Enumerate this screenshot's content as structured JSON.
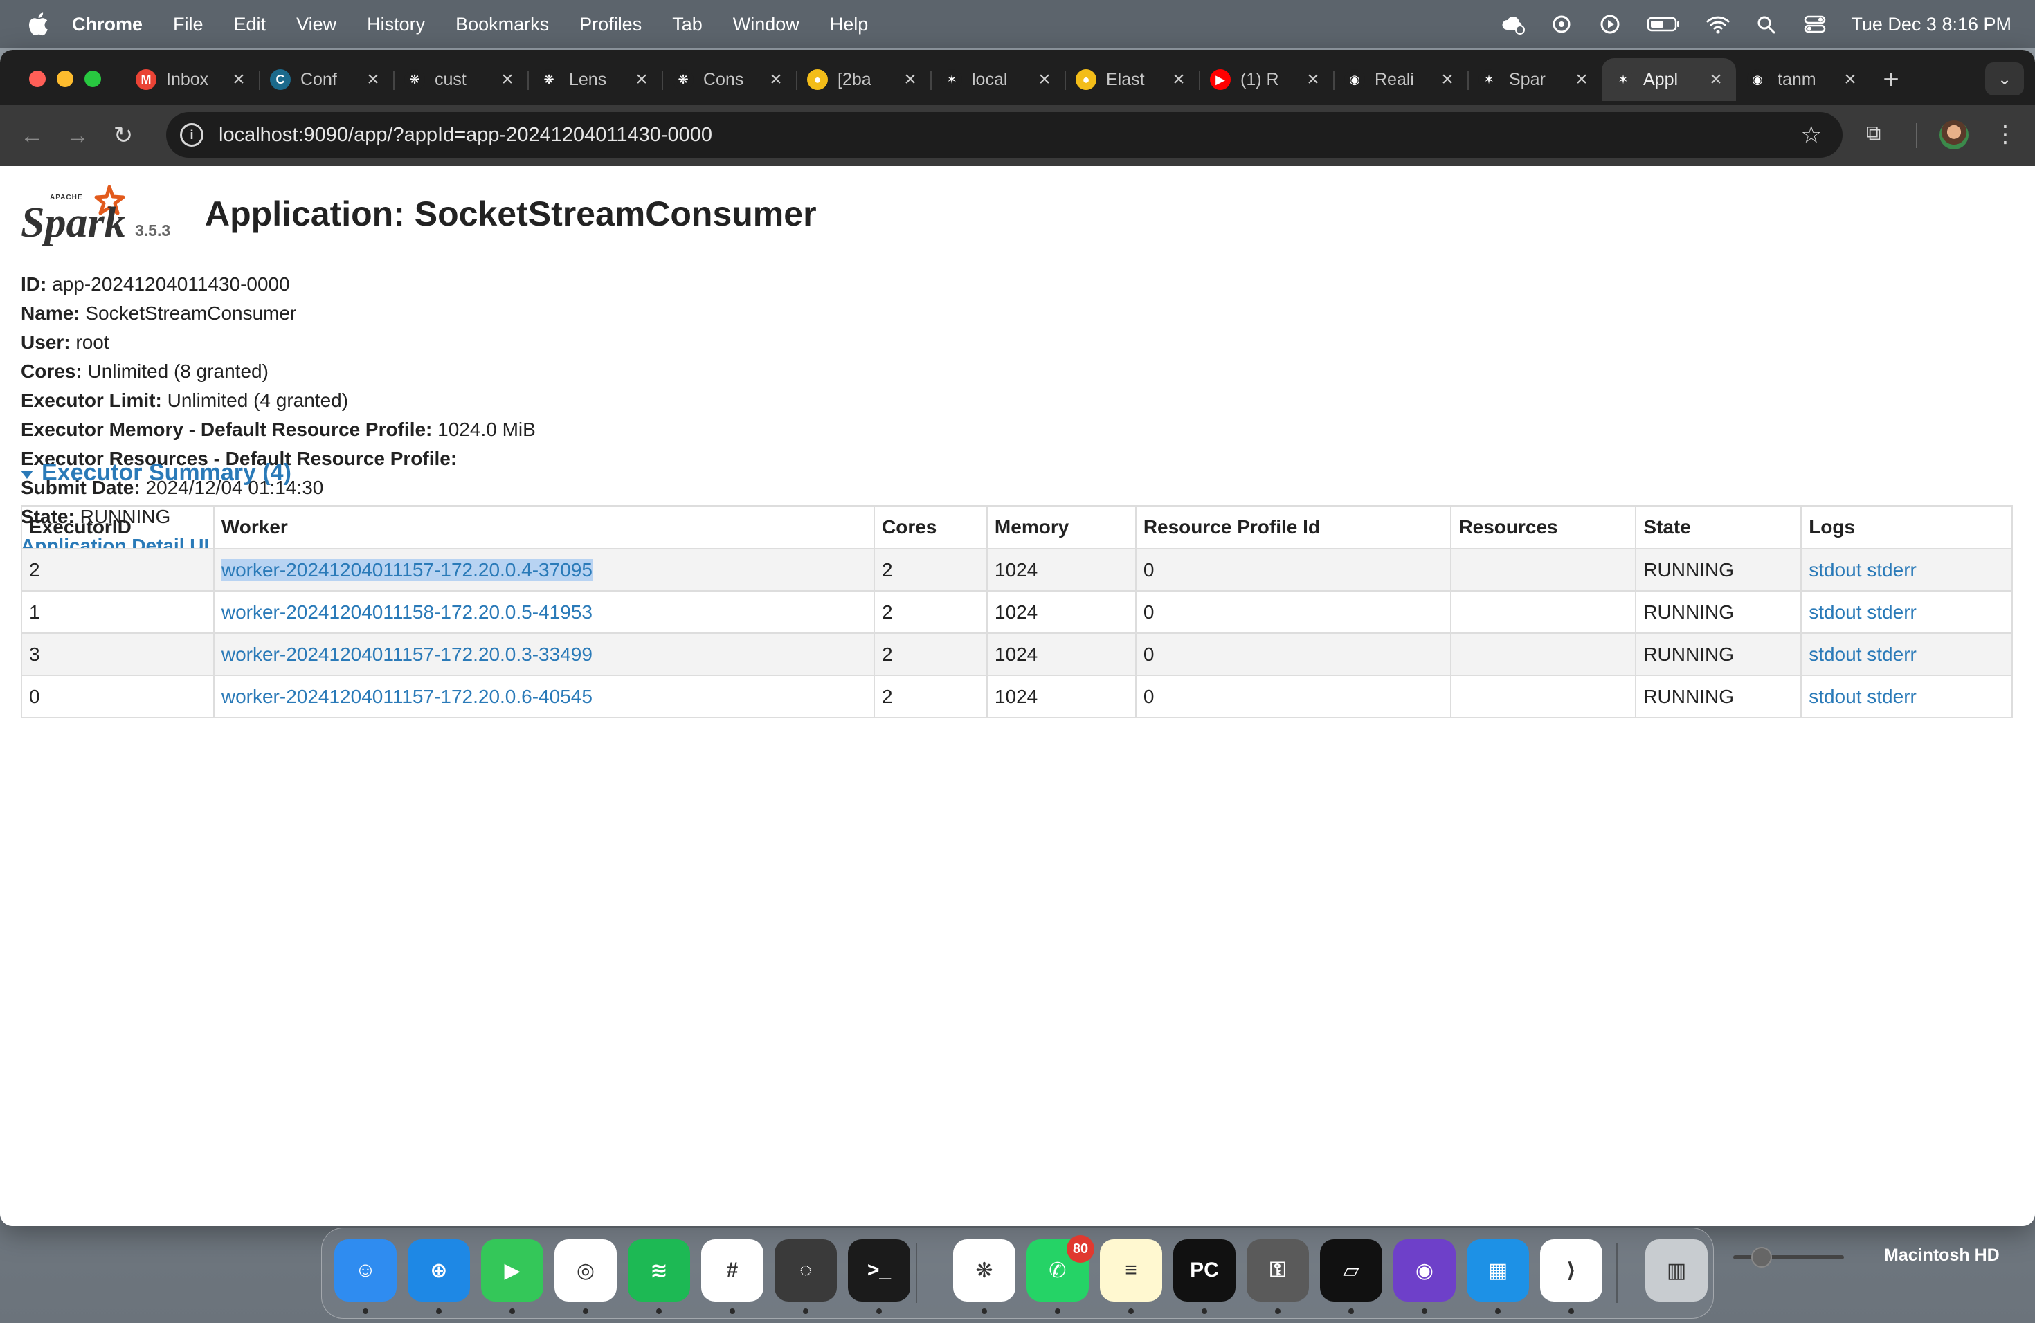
{
  "menubar": {
    "app": "Chrome",
    "items": [
      "File",
      "Edit",
      "View",
      "History",
      "Bookmarks",
      "Profiles",
      "Tab",
      "Window",
      "Help"
    ],
    "clock": "Tue Dec 3  8:16 PM"
  },
  "tabs": [
    {
      "title": "Inbox",
      "favicon": "gmail-icon",
      "color": "#ea4335",
      "glyph": "M"
    },
    {
      "title": "Conf",
      "favicon": "confluent-icon",
      "color": "#1b6a8c",
      "glyph": "C"
    },
    {
      "title": "cust",
      "favicon": "openai-icon",
      "color": "#1f1f1f",
      "glyph": "❋"
    },
    {
      "title": "Lens",
      "favicon": "openai-icon",
      "color": "#1f1f1f",
      "glyph": "❋"
    },
    {
      "title": "Cons",
      "favicon": "openai-icon",
      "color": "#1f1f1f",
      "glyph": "❋"
    },
    {
      "title": "[2ba",
      "favicon": "elastic-icon",
      "color": "#f3bd19",
      "glyph": "●"
    },
    {
      "title": "local",
      "favicon": "spark-icon",
      "color": "#1f1f1f",
      "glyph": "✶"
    },
    {
      "title": "Elast",
      "favicon": "elastic-icon",
      "color": "#f3bd19",
      "glyph": "●"
    },
    {
      "title": "(1) R",
      "favicon": "youtube-icon",
      "color": "#ff0000",
      "glyph": "▶"
    },
    {
      "title": "Reali",
      "favicon": "github-icon",
      "color": "#1f1f1f",
      "glyph": "◉"
    },
    {
      "title": "Spar",
      "favicon": "spark-icon",
      "color": "#1f1f1f",
      "glyph": "✶"
    },
    {
      "title": "Appl",
      "favicon": "spark-icon",
      "color": "#3a3a3a",
      "glyph": "✶",
      "active": true
    },
    {
      "title": "tanm",
      "favicon": "github-icon",
      "color": "#1f1f1f",
      "glyph": "◉"
    }
  ],
  "newtab_label": "+",
  "url": "localhost:9090/app/?appId=app-20241204011430-0000",
  "spark": {
    "version": "3.5.3"
  },
  "page": {
    "title": "Application: SocketStreamConsumer",
    "info": [
      {
        "label": "ID:",
        "value": "app-20241204011430-0000"
      },
      {
        "label": "Name:",
        "value": "SocketStreamConsumer"
      },
      {
        "label": "User:",
        "value": "root"
      },
      {
        "label": "Cores:",
        "value": "Unlimited (8 granted)"
      },
      {
        "label": "Executor Limit:",
        "value": "Unlimited (4 granted)"
      },
      {
        "label": "Executor Memory - Default Resource Profile:",
        "value": "1024.0 MiB"
      },
      {
        "label": "Executor Resources - Default Resource Profile:",
        "value": ""
      },
      {
        "label": "Submit Date:",
        "value": "2024/12/04 01:14:30"
      },
      {
        "label": "State:",
        "value": "RUNNING"
      }
    ],
    "detail_link": "Application Detail UI",
    "summary_title": "Executor Summary (4)"
  },
  "table": {
    "headers": [
      "ExecutorID",
      "Worker",
      "Cores",
      "Memory",
      "Resource Profile Id",
      "Resources",
      "State",
      "Logs"
    ],
    "rows": [
      {
        "id": "2",
        "worker": "worker-20241204011157-172.20.0.4-37095",
        "cores": "2",
        "memory": "1024",
        "rpid": "0",
        "resources": "",
        "state": "RUNNING",
        "stdout": "stdout",
        "stderr": "stderr"
      },
      {
        "id": "1",
        "worker": "worker-20241204011158-172.20.0.5-41953",
        "cores": "2",
        "memory": "1024",
        "rpid": "0",
        "resources": "",
        "state": "RUNNING",
        "stdout": "stdout",
        "stderr": "stderr"
      },
      {
        "id": "3",
        "worker": "worker-20241204011157-172.20.0.3-33499",
        "cores": "2",
        "memory": "1024",
        "rpid": "0",
        "resources": "",
        "state": "RUNNING",
        "stdout": "stdout",
        "stderr": "stderr"
      },
      {
        "id": "0",
        "worker": "worker-20241204011157-172.20.0.6-40545",
        "cores": "2",
        "memory": "1024",
        "rpid": "0",
        "resources": "",
        "state": "RUNNING",
        "stdout": "stdout",
        "stderr": "stderr"
      }
    ]
  },
  "dock": {
    "apps": [
      {
        "name": "finder-icon",
        "color": "#2f8cf0",
        "glyph": "☺"
      },
      {
        "name": "safari-icon",
        "color": "#1e88e5",
        "glyph": "⊕"
      },
      {
        "name": "facetime-icon",
        "color": "#34c759",
        "glyph": "▶"
      },
      {
        "name": "chrome-icon",
        "color": "#ffffff",
        "glyph": "◎"
      },
      {
        "name": "spotify-icon",
        "color": "#1db954",
        "glyph": "≋"
      },
      {
        "name": "slack-icon",
        "color": "#ffffff",
        "glyph": "#"
      },
      {
        "name": "activity-icon",
        "color": "#3a3a3a",
        "glyph": "◌"
      },
      {
        "name": "terminal-icon",
        "color": "#1b1b1b",
        "glyph": ">_"
      },
      {
        "name": "chatgpt-icon",
        "color": "#ffffff",
        "glyph": "❋"
      },
      {
        "name": "whatsapp-icon",
        "color": "#25d366",
        "glyph": "✆",
        "badge": "80"
      },
      {
        "name": "notes-icon",
        "color": "#fff8d0",
        "glyph": "≡"
      },
      {
        "name": "pycharm-icon",
        "color": "#111111",
        "glyph": "PC"
      },
      {
        "name": "keychain-icon",
        "color": "#5a5a5a",
        "glyph": "⚿"
      },
      {
        "name": "cursor-icon",
        "color": "#111111",
        "glyph": "▱"
      },
      {
        "name": "github-desktop-icon",
        "color": "#6e40c9",
        "glyph": "◉"
      },
      {
        "name": "docker-icon",
        "color": "#1d91e6",
        "glyph": "▦"
      },
      {
        "name": "vscode-icon",
        "color": "#ffffff",
        "glyph": "⟩"
      },
      {
        "name": "trash-icon",
        "color": "#c8ccd0",
        "glyph": "▥"
      }
    ],
    "disk_label": "Macintosh HD"
  }
}
